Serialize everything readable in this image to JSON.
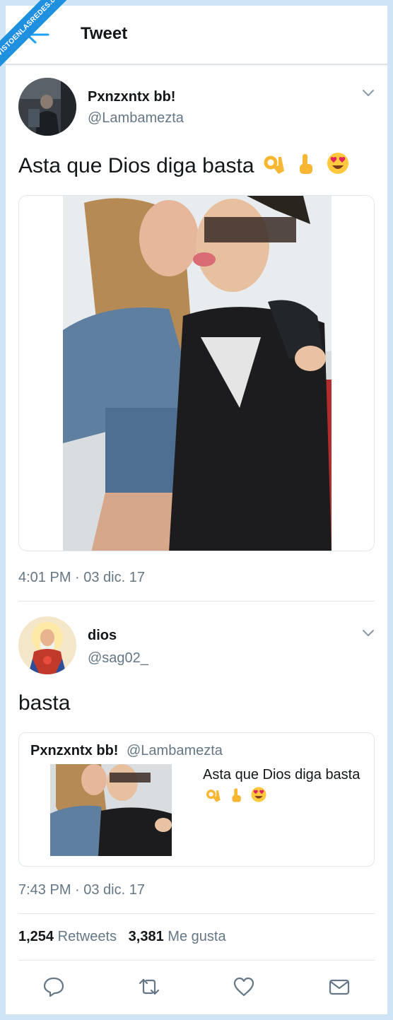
{
  "watermark": "VISTOENLASREDES.com",
  "header": {
    "title": "Tweet"
  },
  "tweet1": {
    "name": "Pxnzxntx bb!",
    "handle": "@Lambamezta",
    "text": "Asta que Dios diga basta",
    "emojis": [
      "ok-hand-emoji",
      "pointing-up-emoji",
      "heart-eyes-emoji"
    ],
    "timestamp": "4:01 PM · 03 dic. 17"
  },
  "tweet2": {
    "name": "dios",
    "handle": "@sag02_",
    "text": "basta",
    "timestamp": "7:43 PM · 03 dic. 17",
    "quote": {
      "name": "Pxnzxntx bb!",
      "handle": "@Lambamezta",
      "text": "Asta que Dios diga basta"
    }
  },
  "stats": {
    "retweets_count": "1,254",
    "retweets_label": "Retweets",
    "likes_count": "3,381",
    "likes_label": "Me gusta"
  },
  "colors": {
    "background": "#cfe4f5",
    "accent": "#1da1f2",
    "secondary_text": "#657786",
    "border": "#e1e8ed"
  }
}
